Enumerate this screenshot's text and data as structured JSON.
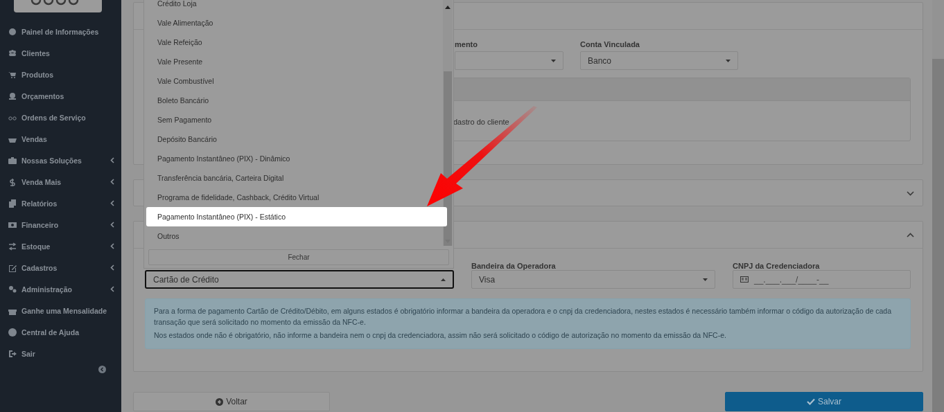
{
  "sidebar": {
    "items": [
      {
        "label": "Painel de Informações",
        "expandable": false
      },
      {
        "label": "Clientes",
        "expandable": false
      },
      {
        "label": "Produtos",
        "expandable": false
      },
      {
        "label": "Orçamentos",
        "expandable": false
      },
      {
        "label": "Ordens de Serviço",
        "expandable": false
      },
      {
        "label": "Vendas",
        "expandable": false
      },
      {
        "label": "Nossas Soluções",
        "expandable": true
      },
      {
        "label": "Venda Mais",
        "expandable": true
      },
      {
        "label": "Relatórios",
        "expandable": true
      },
      {
        "label": "Financeiro",
        "expandable": true
      },
      {
        "label": "Estoque",
        "expandable": true
      },
      {
        "label": "Cadastros",
        "expandable": true
      },
      {
        "label": "Administração",
        "expandable": true
      },
      {
        "label": "Ganhe uma Mensalidade",
        "expandable": false
      },
      {
        "label": "Central de Ajuda",
        "expandable": false
      },
      {
        "label": "Sair",
        "expandable": false
      }
    ]
  },
  "panel_1": {
    "field_1": {
      "label": "mento"
    },
    "field_2": {
      "label": "Conta Vinculada",
      "value": "Banco"
    },
    "note": "dastro do cliente"
  },
  "panel_2": {
    "expanded": false
  },
  "panel_3": {
    "expanded": true,
    "payment_select": {
      "value": "Cartão de Crédito"
    },
    "operator_flag": {
      "label": "Bandeira da Operadora",
      "value": "Visa"
    },
    "cnpj": {
      "label": "CNPJ da Credenciadora",
      "placeholder": "__.___.___/____-__"
    },
    "info": [
      "Para a forma de pagamento Cartão de Crédito/Débito, em alguns estados é obrigatório informar a bandeira da operadora e o cnpj da credenciadora, nestes estados é necessário também informar o código da autorização de cada transação que será solicitado no momento da emissão da NFC-e.",
      "Nos estados onde não é obrigatório, não informe a bandeira nem o cnpj da credenciadora, assim não será solicitado o código de autorização no momento da emissão da NFC-e."
    ]
  },
  "dropdown": {
    "options": [
      {
        "label": "Crédito Loja",
        "selected": false
      },
      {
        "label": "Vale Alimentação",
        "selected": false
      },
      {
        "label": "Vale Refeição",
        "selected": false
      },
      {
        "label": "Vale Presente",
        "selected": false
      },
      {
        "label": "Vale Combustível",
        "selected": false
      },
      {
        "label": "Boleto Bancário",
        "selected": false
      },
      {
        "label": "Sem Pagamento",
        "selected": false
      },
      {
        "label": "Depósito Bancário",
        "selected": false
      },
      {
        "label": "Pagamento Instantâneo (PIX) - Dinâmico",
        "selected": false
      },
      {
        "label": "Transferência bancária, Carteira Digital",
        "selected": false
      },
      {
        "label": "Programa de fidelidade, Cashback, Crédito Virtual",
        "selected": false
      },
      {
        "label": "Pagamento Instantâneo (PIX) - Estático",
        "selected": true
      },
      {
        "label": "Outros",
        "selected": false
      }
    ],
    "close_button": "Fechar"
  },
  "buttons": [
    {
      "label": "Voltar",
      "kind": "back"
    },
    {
      "label": "Salvar",
      "kind": "save"
    }
  ]
}
